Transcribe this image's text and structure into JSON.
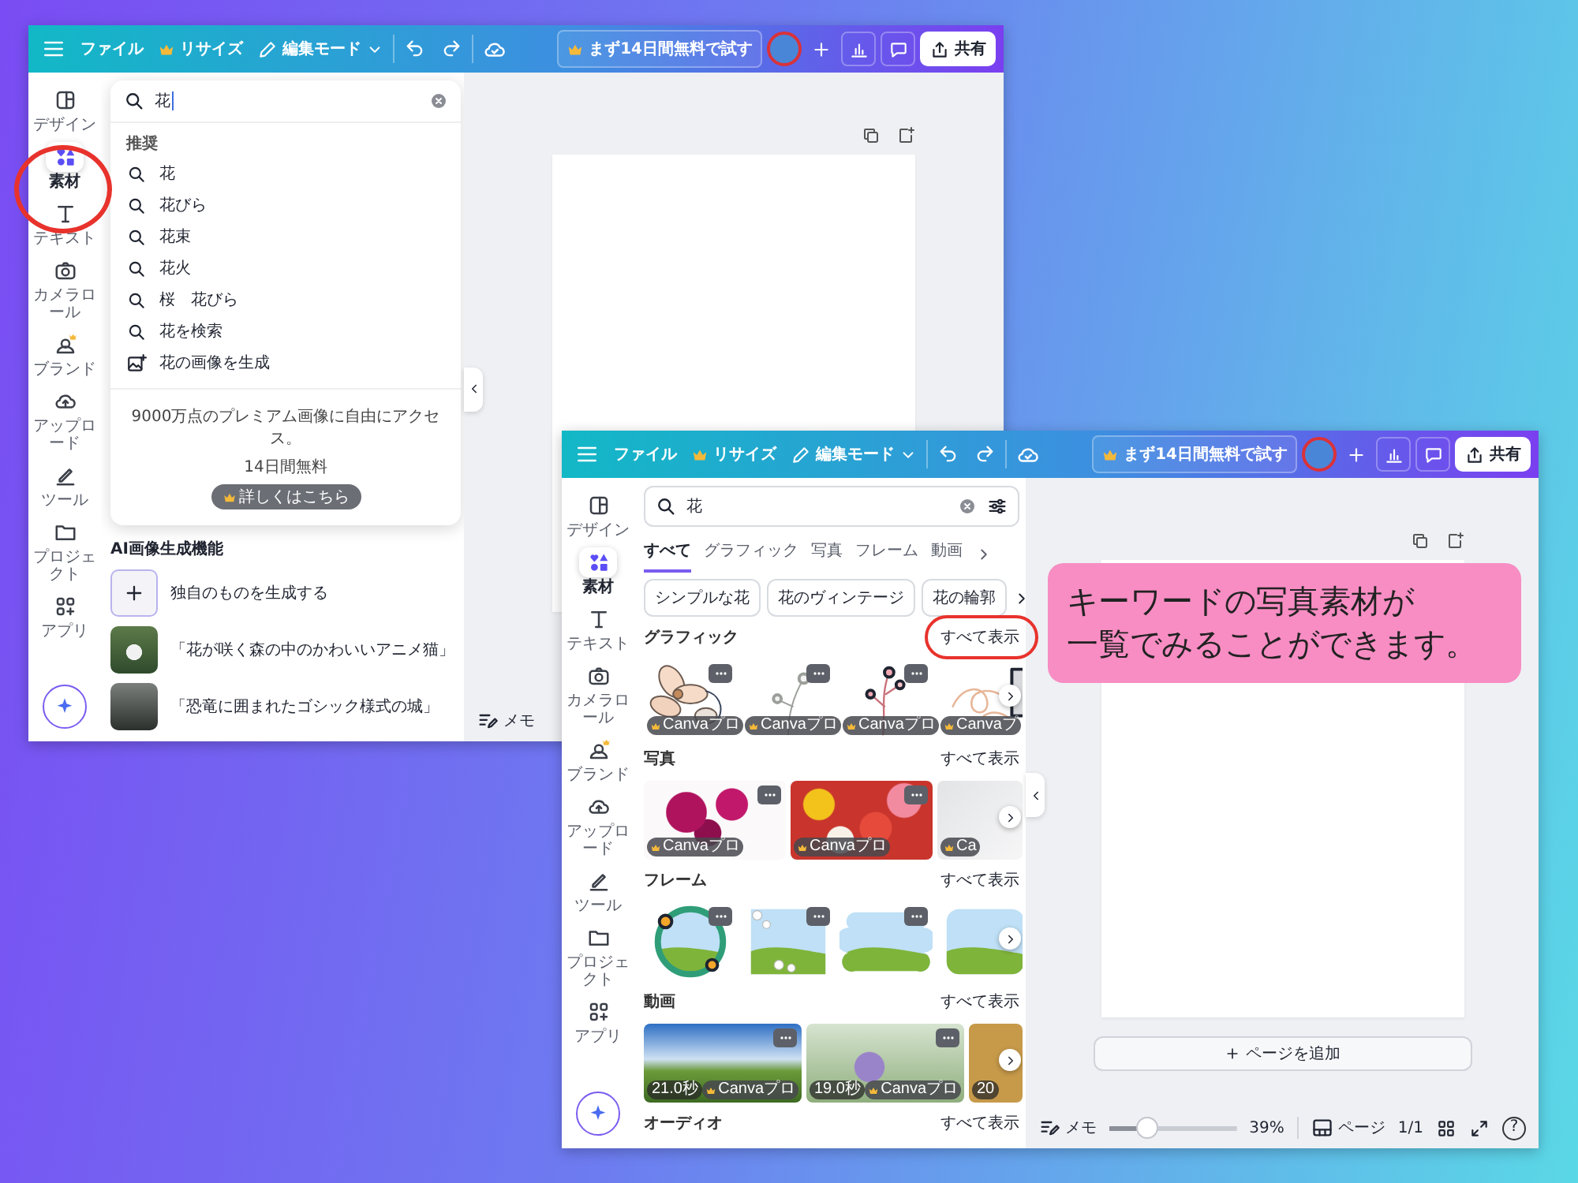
{
  "windows": [
    {
      "kind": "search_suggestions",
      "topbar": {
        "file": "ファイル",
        "resize": "リサイズ",
        "edit_mode": "編集モード",
        "trial": "まず14日間無料で試す",
        "share": "共有"
      },
      "rail": [
        {
          "kind": "design",
          "label": "デザイン",
          "selected": false
        },
        {
          "kind": "elements",
          "label": "素材",
          "selected": true
        },
        {
          "kind": "text",
          "label": "テキスト",
          "selected": false
        },
        {
          "kind": "camera",
          "label": "カメラロール",
          "selected": false
        },
        {
          "kind": "brand",
          "label": "ブランド",
          "selected": false
        },
        {
          "kind": "upload",
          "label": "アップロード",
          "selected": false
        },
        {
          "kind": "tools",
          "label": "ツール",
          "selected": false
        },
        {
          "kind": "projects",
          "label": "プロジェクト",
          "selected": false
        },
        {
          "kind": "apps",
          "label": "アプリ",
          "selected": false
        }
      ],
      "search": {
        "value": "花"
      },
      "suggestions": {
        "heading": "推奨",
        "items": [
          {
            "kind": "search",
            "label": "花"
          },
          {
            "kind": "search",
            "label": "花びら"
          },
          {
            "kind": "search",
            "label": "花束"
          },
          {
            "kind": "search",
            "label": "花火"
          },
          {
            "kind": "search",
            "label": "桜　花びら"
          },
          {
            "kind": "search",
            "label": "花を検索"
          },
          {
            "kind": "generate",
            "label": "花の画像を生成"
          }
        ]
      },
      "promo": {
        "text": "9000万点のプレミアム画像に自由にアクセス。",
        "subtext": "14日間無料",
        "link": "詳しくはこちら"
      },
      "ai": {
        "title": "AI画像生成機能",
        "items": [
          {
            "kind": "create",
            "label": "独自のものを生成する"
          },
          {
            "kind": "image",
            "label": "「花が咲く森の中のかわいいアニメ猫」"
          },
          {
            "kind": "image",
            "label": "「恐竜に囲まれたゴシック様式の城」"
          }
        ]
      },
      "canvas": {
        "memo": "メモ"
      }
    },
    {
      "kind": "search_results",
      "topbar": {
        "file": "ファイル",
        "resize": "リサイズ",
        "edit_mode": "編集モード",
        "trial": "まず14日間無料で試す",
        "share": "共有"
      },
      "rail": [
        {
          "kind": "design",
          "label": "デザイン",
          "selected": false
        },
        {
          "kind": "elements",
          "label": "素材",
          "selected": true
        },
        {
          "kind": "text",
          "label": "テキスト",
          "selected": false
        },
        {
          "kind": "camera",
          "label": "カメラロール",
          "selected": false
        },
        {
          "kind": "brand",
          "label": "ブランド",
          "selected": false
        },
        {
          "kind": "upload",
          "label": "アップロード",
          "selected": false
        },
        {
          "kind": "tools",
          "label": "ツール",
          "selected": false
        },
        {
          "kind": "projects",
          "label": "プロジェクト",
          "selected": false
        },
        {
          "kind": "apps",
          "label": "アプリ",
          "selected": false
        }
      ],
      "search": {
        "value": "花"
      },
      "tabs": [
        {
          "label": "すべて",
          "selected": true
        },
        {
          "label": "グラフィック",
          "selected": false
        },
        {
          "label": "写真",
          "selected": false
        },
        {
          "label": "フレーム",
          "selected": false
        },
        {
          "label": "動画",
          "selected": false
        }
      ],
      "chips": [
        "シンプルな花",
        "花のヴィンテージ",
        "花の輪郭"
      ],
      "sections": [
        {
          "kind": "graphic",
          "title": "グラフィック",
          "see_all": "すべて表示",
          "items": [
            {
              "badge": "Canvaプロ"
            },
            {
              "badge": "Canvaプロ"
            },
            {
              "badge": "Canvaプロ"
            },
            {
              "badge": "Canvaプ"
            }
          ]
        },
        {
          "kind": "photo",
          "title": "写真",
          "see_all": "すべて表示",
          "items": [
            {
              "badge": "Canvaプロ"
            },
            {
              "badge": "Canvaプロ"
            },
            {
              "badge": "Ca"
            }
          ]
        },
        {
          "kind": "frame",
          "title": "フレーム",
          "see_all": "すべて表示",
          "items": [
            {
              "kind": "wreath"
            },
            {
              "kind": "daisies"
            },
            {
              "kind": "cloud"
            },
            {
              "kind": "bubble"
            }
          ]
        },
        {
          "kind": "video",
          "title": "動画",
          "see_all": "すべて表示",
          "items": [
            {
              "duration": "21.0秒",
              "badge": "Canvaプロ"
            },
            {
              "duration": "19.0秒",
              "badge": "Canvaプロ"
            },
            {
              "duration": "20"
            }
          ]
        },
        {
          "kind": "audio",
          "title": "オーディオ",
          "see_all": "すべて表示"
        }
      ],
      "canvas": {
        "add_page": "ページを追加",
        "memo": "メモ",
        "zoom": {
          "level": 0.3
        },
        "zoom_reading": "39%",
        "pages": "ページ",
        "page_count": "1/1",
        "help": "?"
      }
    }
  ],
  "callout": {
    "lines": [
      "キーワードの写真素材が",
      "一覧でみることができます。"
    ]
  }
}
